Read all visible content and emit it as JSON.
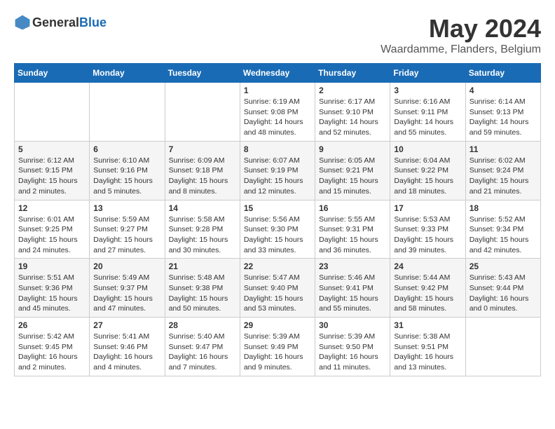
{
  "logo": {
    "text_general": "General",
    "text_blue": "Blue"
  },
  "title": {
    "month_year": "May 2024",
    "location": "Waardamme, Flanders, Belgium"
  },
  "weekdays": [
    "Sunday",
    "Monday",
    "Tuesday",
    "Wednesday",
    "Thursday",
    "Friday",
    "Saturday"
  ],
  "weeks": [
    [
      {
        "day": "",
        "info": ""
      },
      {
        "day": "",
        "info": ""
      },
      {
        "day": "",
        "info": ""
      },
      {
        "day": "1",
        "info": "Sunrise: 6:19 AM\nSunset: 9:08 PM\nDaylight: 14 hours\nand 48 minutes."
      },
      {
        "day": "2",
        "info": "Sunrise: 6:17 AM\nSunset: 9:10 PM\nDaylight: 14 hours\nand 52 minutes."
      },
      {
        "day": "3",
        "info": "Sunrise: 6:16 AM\nSunset: 9:11 PM\nDaylight: 14 hours\nand 55 minutes."
      },
      {
        "day": "4",
        "info": "Sunrise: 6:14 AM\nSunset: 9:13 PM\nDaylight: 14 hours\nand 59 minutes."
      }
    ],
    [
      {
        "day": "5",
        "info": "Sunrise: 6:12 AM\nSunset: 9:15 PM\nDaylight: 15 hours\nand 2 minutes."
      },
      {
        "day": "6",
        "info": "Sunrise: 6:10 AM\nSunset: 9:16 PM\nDaylight: 15 hours\nand 5 minutes."
      },
      {
        "day": "7",
        "info": "Sunrise: 6:09 AM\nSunset: 9:18 PM\nDaylight: 15 hours\nand 8 minutes."
      },
      {
        "day": "8",
        "info": "Sunrise: 6:07 AM\nSunset: 9:19 PM\nDaylight: 15 hours\nand 12 minutes."
      },
      {
        "day": "9",
        "info": "Sunrise: 6:05 AM\nSunset: 9:21 PM\nDaylight: 15 hours\nand 15 minutes."
      },
      {
        "day": "10",
        "info": "Sunrise: 6:04 AM\nSunset: 9:22 PM\nDaylight: 15 hours\nand 18 minutes."
      },
      {
        "day": "11",
        "info": "Sunrise: 6:02 AM\nSunset: 9:24 PM\nDaylight: 15 hours\nand 21 minutes."
      }
    ],
    [
      {
        "day": "12",
        "info": "Sunrise: 6:01 AM\nSunset: 9:25 PM\nDaylight: 15 hours\nand 24 minutes."
      },
      {
        "day": "13",
        "info": "Sunrise: 5:59 AM\nSunset: 9:27 PM\nDaylight: 15 hours\nand 27 minutes."
      },
      {
        "day": "14",
        "info": "Sunrise: 5:58 AM\nSunset: 9:28 PM\nDaylight: 15 hours\nand 30 minutes."
      },
      {
        "day": "15",
        "info": "Sunrise: 5:56 AM\nSunset: 9:30 PM\nDaylight: 15 hours\nand 33 minutes."
      },
      {
        "day": "16",
        "info": "Sunrise: 5:55 AM\nSunset: 9:31 PM\nDaylight: 15 hours\nand 36 minutes."
      },
      {
        "day": "17",
        "info": "Sunrise: 5:53 AM\nSunset: 9:33 PM\nDaylight: 15 hours\nand 39 minutes."
      },
      {
        "day": "18",
        "info": "Sunrise: 5:52 AM\nSunset: 9:34 PM\nDaylight: 15 hours\nand 42 minutes."
      }
    ],
    [
      {
        "day": "19",
        "info": "Sunrise: 5:51 AM\nSunset: 9:36 PM\nDaylight: 15 hours\nand 45 minutes."
      },
      {
        "day": "20",
        "info": "Sunrise: 5:49 AM\nSunset: 9:37 PM\nDaylight: 15 hours\nand 47 minutes."
      },
      {
        "day": "21",
        "info": "Sunrise: 5:48 AM\nSunset: 9:38 PM\nDaylight: 15 hours\nand 50 minutes."
      },
      {
        "day": "22",
        "info": "Sunrise: 5:47 AM\nSunset: 9:40 PM\nDaylight: 15 hours\nand 53 minutes."
      },
      {
        "day": "23",
        "info": "Sunrise: 5:46 AM\nSunset: 9:41 PM\nDaylight: 15 hours\nand 55 minutes."
      },
      {
        "day": "24",
        "info": "Sunrise: 5:44 AM\nSunset: 9:42 PM\nDaylight: 15 hours\nand 58 minutes."
      },
      {
        "day": "25",
        "info": "Sunrise: 5:43 AM\nSunset: 9:44 PM\nDaylight: 16 hours\nand 0 minutes."
      }
    ],
    [
      {
        "day": "26",
        "info": "Sunrise: 5:42 AM\nSunset: 9:45 PM\nDaylight: 16 hours\nand 2 minutes."
      },
      {
        "day": "27",
        "info": "Sunrise: 5:41 AM\nSunset: 9:46 PM\nDaylight: 16 hours\nand 4 minutes."
      },
      {
        "day": "28",
        "info": "Sunrise: 5:40 AM\nSunset: 9:47 PM\nDaylight: 16 hours\nand 7 minutes."
      },
      {
        "day": "29",
        "info": "Sunrise: 5:39 AM\nSunset: 9:49 PM\nDaylight: 16 hours\nand 9 minutes."
      },
      {
        "day": "30",
        "info": "Sunrise: 5:39 AM\nSunset: 9:50 PM\nDaylight: 16 hours\nand 11 minutes."
      },
      {
        "day": "31",
        "info": "Sunrise: 5:38 AM\nSunset: 9:51 PM\nDaylight: 16 hours\nand 13 minutes."
      },
      {
        "day": "",
        "info": ""
      }
    ]
  ]
}
